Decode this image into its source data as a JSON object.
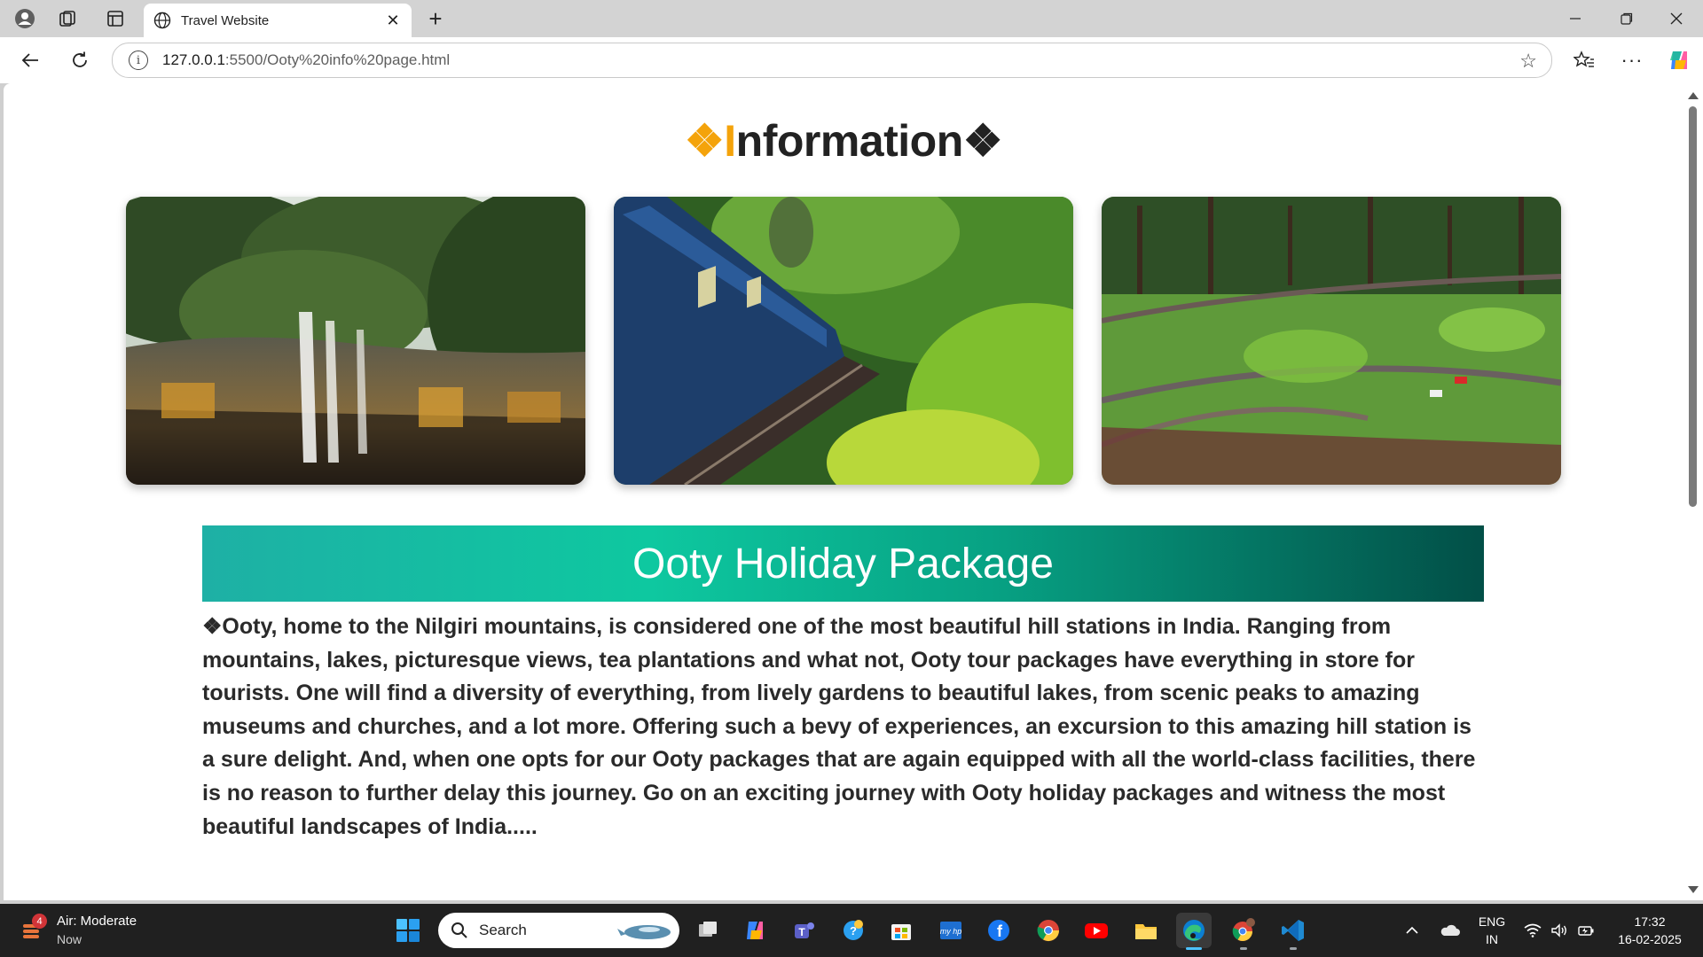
{
  "browser": {
    "tab_title": "Travel Website",
    "url_host": "127.0.0.1",
    "url_path": ":5500/Ooty%20info%20page.html"
  },
  "page": {
    "heading_prefix": "❖",
    "heading_first": "I",
    "heading_rest": "nformation",
    "heading_suffix": "❖",
    "banner_title": "Ooty Holiday Package",
    "description": "❖Ooty, home to the Nilgiri mountains, is considered one of the most beautiful hill stations in India. Ranging from mountains, lakes, picturesque views, tea plantations and what not, Ooty tour packages have everything in store for tourists. One will find a diversity of everything, from lively gardens to beautiful lakes, from scenic peaks to amazing museums and churches, and a lot more. Offering such a bevy of experiences, an excursion to this amazing hill station is a sure delight. And, when one opts for our Ooty packages that are again equipped with all the world-class facilities, there is no reason to further delay this journey. Go on an exciting journey with Ooty holiday packages and witness the most beautiful landscapes of India.....",
    "photos": [
      "waterfall-photo",
      "toy-train-photo",
      "tea-valley-photo"
    ]
  },
  "taskbar": {
    "weather_title": "Air: Moderate",
    "weather_sub": "Now",
    "weather_badge": "4",
    "search_label": "Search",
    "lang_top": "ENG",
    "lang_bottom": "IN",
    "time": "17:32",
    "date": "16-02-2025"
  },
  "colors": {
    "accent": "#f4a30b",
    "banner_start": "#1eb0a5",
    "banner_end": "#024f47"
  }
}
